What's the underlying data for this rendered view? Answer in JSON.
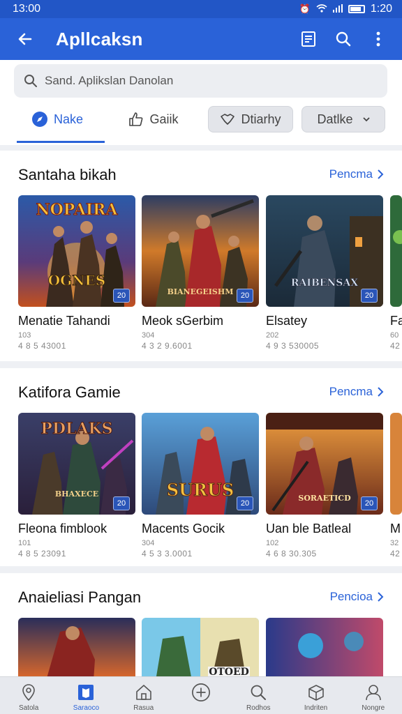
{
  "status_bar": {
    "time_left": "13:00",
    "time_right": "1:20"
  },
  "app_bar": {
    "title": "Apllcaksn"
  },
  "search": {
    "placeholder": "Sand. Aplikslan Danolan"
  },
  "tabs": [
    {
      "label": "Nake",
      "icon": "compass-icon"
    },
    {
      "label": "Gaiik",
      "icon": "thumbs-up-icon"
    },
    {
      "label": "Dtiarhy",
      "icon": "handshake-icon"
    },
    {
      "label": "Datlke",
      "icon": "chevron-down-icon"
    }
  ],
  "sections": [
    {
      "title": "Santaha bikah",
      "more": "Pencma",
      "cards": [
        {
          "name": "Menatie Tahandi",
          "sub": "103",
          "meta": "4 8 5 43001",
          "overlay_top": "NOPAIRA",
          "overlay_bottom": "OGNES",
          "badge": "20"
        },
        {
          "name": "Meok sGerbim",
          "sub": "304",
          "meta": "4 3 2 9.6001",
          "overlay_top": "",
          "overlay_bottom": "BIANEGEISHM",
          "badge": "20"
        },
        {
          "name": "Elsatey",
          "sub": "202",
          "meta": "4 9 3 530005",
          "overlay_top": "",
          "overlay_bottom": "RAIBENSAX",
          "badge": "20"
        },
        {
          "name": "Fa",
          "sub": "60",
          "meta": "42",
          "overlay_top": "",
          "overlay_bottom": "",
          "badge": ""
        }
      ]
    },
    {
      "title": "Katiforа Gamie",
      "more": "Pencma",
      "cards": [
        {
          "name": "Fleona fimblook",
          "sub": "101",
          "meta": "4 8 5 23091",
          "overlay_top": "PDLAKS",
          "overlay_bottom": "BHAXECE",
          "badge": "20"
        },
        {
          "name": "Macents Gocik",
          "sub": "304",
          "meta": "4 5 3 3.0001",
          "overlay_top": "",
          "overlay_bottom": "SURUS",
          "badge": "20"
        },
        {
          "name": "Uan ble Batleal",
          "sub": "102",
          "meta": "4 6 8 30.305",
          "overlay_top": "",
          "overlay_bottom": "SORAETICD",
          "badge": "20"
        },
        {
          "name": "M",
          "sub": "32",
          "meta": "42",
          "overlay_top": "",
          "overlay_bottom": "",
          "badge": ""
        }
      ]
    },
    {
      "title": "Anaieliasi Pangan",
      "more": "Pencioa",
      "cards": [
        {
          "name": "",
          "sub": "",
          "meta": "",
          "overlay_top": "",
          "overlay_bottom": "",
          "badge": ""
        },
        {
          "name": "",
          "sub": "",
          "meta": "",
          "overlay_top": "",
          "overlay_bottom": "OTOED",
          "badge": ""
        },
        {
          "name": "",
          "sub": "",
          "meta": "",
          "overlay_top": "",
          "overlay_bottom": "",
          "badge": ""
        }
      ]
    }
  ],
  "bottom_nav": [
    {
      "label": "Satola",
      "icon": "map-pin-icon",
      "active": false
    },
    {
      "label": "Saraoco",
      "icon": "book-icon",
      "active": true
    },
    {
      "label": "Rasua",
      "icon": "home-icon",
      "active": false
    },
    {
      "label": "",
      "icon": "plus-circle-icon",
      "active": false
    },
    {
      "label": "Rodhos",
      "icon": "search-icon",
      "active": false
    },
    {
      "label": "Indriten",
      "icon": "box-icon",
      "active": false
    },
    {
      "label": "Nongre",
      "icon": "person-icon",
      "active": false
    }
  ],
  "colors": {
    "primary": "#2a62d8",
    "status_bar": "#2256c6",
    "background": "#eef0f4"
  }
}
